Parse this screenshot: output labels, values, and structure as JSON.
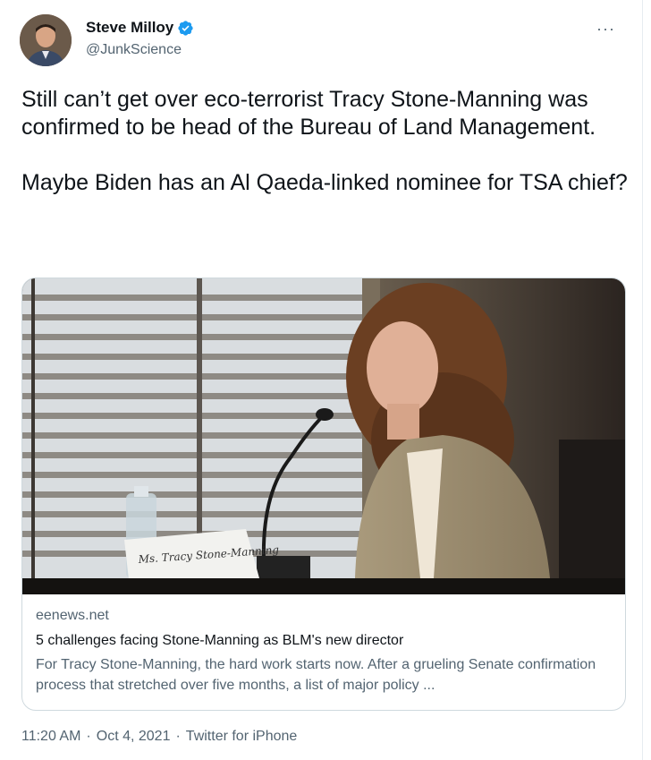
{
  "user": {
    "display_name": "Steve Milloy",
    "handle": "@JunkScience",
    "verified": true
  },
  "more_label": "···",
  "tweet": {
    "paragraphs": [
      "Still can’t get over eco-terrorist Tracy Stone-Manning was confirmed to be head of the Bureau of Land Management.",
      "Maybe Biden has an Al Qaeda-linked nominee for TSA chief?"
    ]
  },
  "card": {
    "domain": "eenews.net",
    "title": "5 challenges facing Stone-Manning as BLM's new director",
    "description": "For Tracy Stone-Manning, the hard work starts now. After a grueling Senate confirmation process that stretched over five months, a list of major policy ...",
    "nameplate": "Ms. Tracy Stone-Manning"
  },
  "meta": {
    "time": "11:20 AM",
    "separator": "·",
    "date": "Oct 4, 2021",
    "source": "Twitter for iPhone"
  },
  "colors": {
    "verified": "#1d9bf0",
    "secondary_text": "#536471",
    "primary_text": "#0f1419",
    "border": "#cfd9de"
  }
}
